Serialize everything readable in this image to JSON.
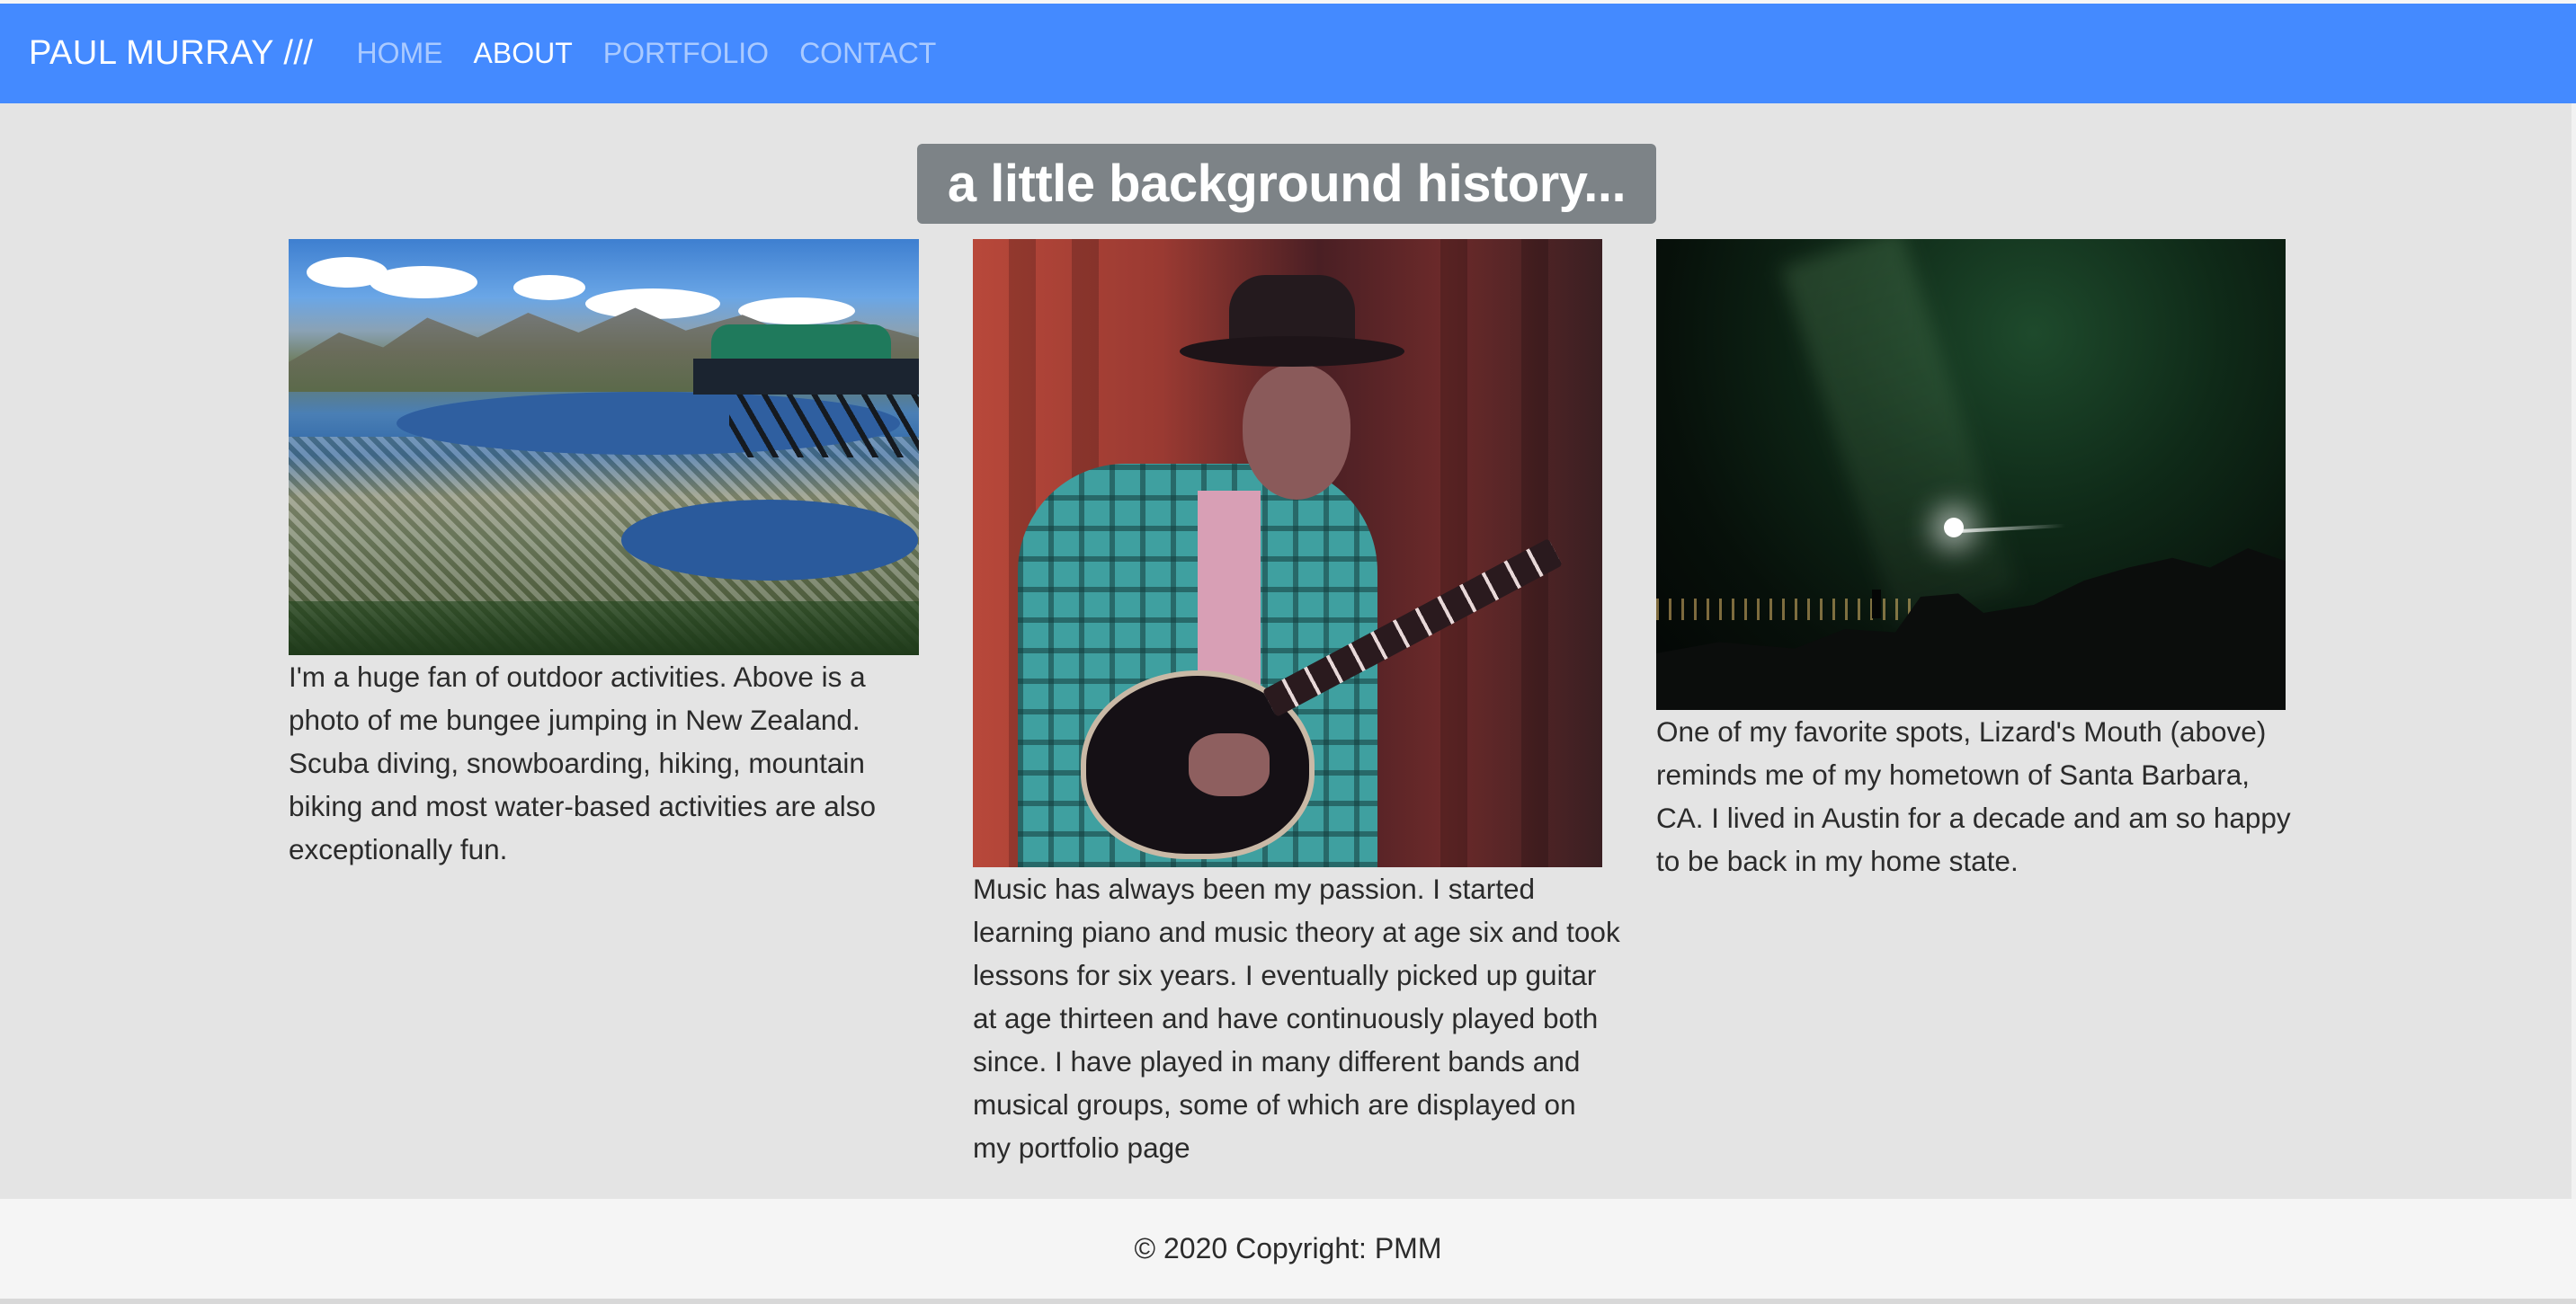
{
  "navbar": {
    "brand": "PAUL MURRAY ///",
    "links": [
      {
        "label": "HOME",
        "active": false
      },
      {
        "label": "ABOUT",
        "active": true
      },
      {
        "label": "PORTFOLIO",
        "active": false
      },
      {
        "label": "CONTACT",
        "active": false
      }
    ]
  },
  "main": {
    "heading": "a little background history...",
    "columns": [
      {
        "image": "bungee-jump-new-zealand-photo",
        "caption": "I'm a huge fan of outdoor activities. Above is a photo of me bungee jumping in New Zealand. Scuba diving, snowboarding, hiking, mountain biking and most water-based activities are also exceptionally fun."
      },
      {
        "image": "guitarist-on-stage-photo",
        "caption": "Music has always been my passion. I started learning piano and music theory at age six and took lessons for six years. I eventually picked up guitar at age thirteen and have continuously played both since. I have played in many different bands and musical groups, some of which are displayed on my portfolio page"
      },
      {
        "image": "lizards-mouth-night-sky-photo",
        "caption": "One of my favorite spots, Lizard's Mouth (above) reminds me of my hometown of Santa Barbara, CA. I lived in Austin for a decade and am so happy to be back in my home state."
      }
    ]
  },
  "footer": {
    "copyright": "© 2020 Copyright: PMM"
  },
  "colors": {
    "navbar": "#448aff",
    "page_background": "#e4e4e4",
    "heading_badge": "#7d8387",
    "footer_background": "#f5f5f5",
    "text": "#2b2b2b"
  }
}
